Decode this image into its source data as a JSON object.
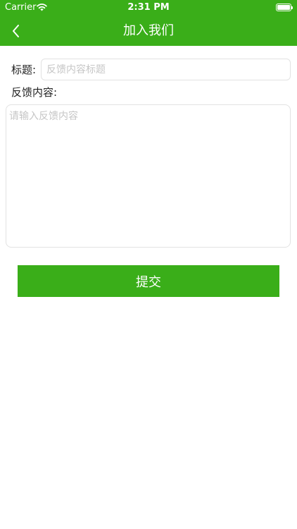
{
  "status_bar": {
    "carrier": "Carrier",
    "time": "2:31 PM",
    "battery_level": 1.0,
    "wifi_icon": "wifi-icon",
    "battery_icon": "battery-icon"
  },
  "nav": {
    "title": "加入我们",
    "back_icon": "chevron-left-icon"
  },
  "form": {
    "title_label": "标题:",
    "title_placeholder": "反馈内容标题",
    "title_value": "",
    "content_label": "反馈内容:",
    "content_placeholder": "请输入反馈内容",
    "content_value": "",
    "submit_label": "提交"
  },
  "colors": {
    "accent": "#3aae19",
    "border": "#e2e2e2",
    "placeholder": "#c6c6c6"
  }
}
